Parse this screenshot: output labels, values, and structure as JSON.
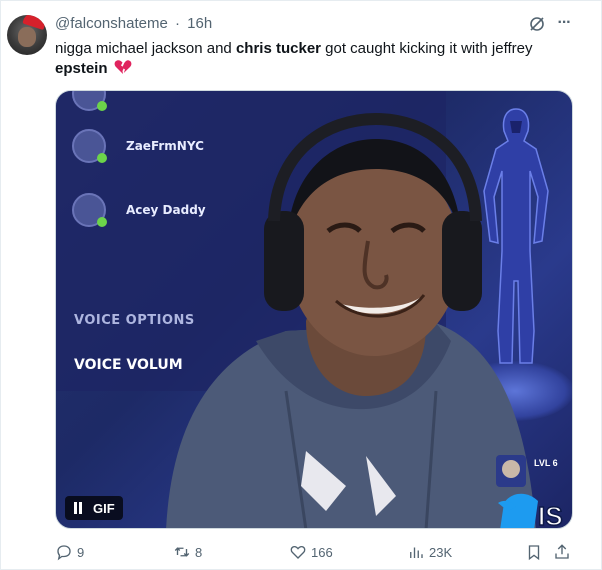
{
  "tweet": {
    "handle": "@falconshateme",
    "separator": "·",
    "time": "16h",
    "text_prefix": "nigga michael jackson and ",
    "text_bold_1": "chris tucker",
    "text_middle": " got caught kicking it with jeffrey ",
    "text_bold_2": "epstein",
    "emoji": "broken-heart-icon"
  },
  "media": {
    "friends": [
      {
        "name": "ZaeFrmNYC"
      },
      {
        "name": "Acey Daddy"
      }
    ],
    "voice_options": "VOICE OPTIONS",
    "voice_volume": "VOICE VOLUM",
    "gif_label": "GIF",
    "badge_text": "LVL 6",
    "badge_logo": "IS"
  },
  "actions": {
    "replies": "9",
    "reposts": "8",
    "likes": "166",
    "views": "23K"
  },
  "colors": {
    "muted": "#536471",
    "broken_heart": "#e0245e",
    "twitter_blue": "#1d9bf0"
  }
}
